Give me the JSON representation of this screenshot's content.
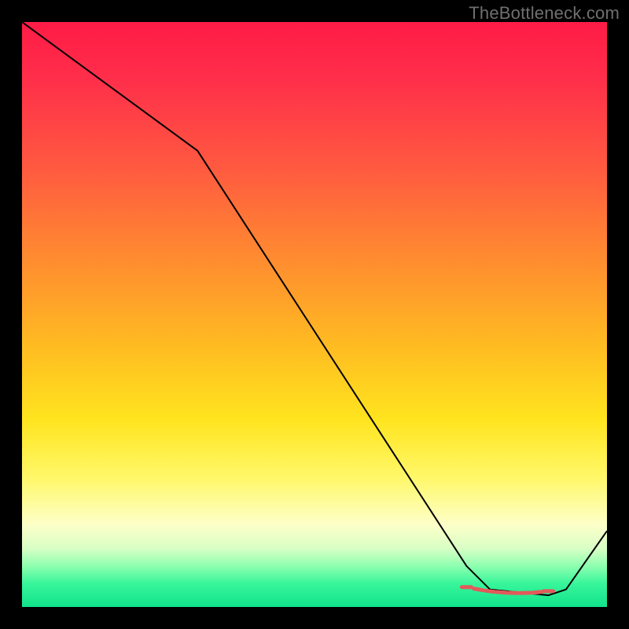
{
  "watermark": "TheBottleneck.com",
  "chart_data": {
    "type": "line",
    "title": "",
    "xlabel": "",
    "ylabel": "",
    "xlim": [
      0,
      100
    ],
    "ylim": [
      0,
      100
    ],
    "grid": false,
    "legend": false,
    "background_gradient": {
      "orientation": "vertical",
      "stops": [
        {
          "pos": 0.0,
          "color": "#ff1b46"
        },
        {
          "pos": 0.25,
          "color": "#ff5a40"
        },
        {
          "pos": 0.55,
          "color": "#ffba22"
        },
        {
          "pos": 0.78,
          "color": "#fff86a"
        },
        {
          "pos": 0.93,
          "color": "#8dffb0"
        },
        {
          "pos": 1.0,
          "color": "#11e38b"
        }
      ]
    },
    "series": [
      {
        "name": "curve",
        "color": "#000000",
        "style": "line",
        "x": [
          0,
          30,
          76,
          80,
          90,
          93,
          100
        ],
        "values": [
          100,
          78,
          7,
          3,
          2,
          3,
          13
        ]
      },
      {
        "name": "optimum-markers",
        "color": "#e25a5a",
        "style": "markers",
        "x": [
          76,
          78,
          80,
          82,
          84,
          86,
          88,
          90
        ],
        "values": [
          3.4,
          3.0,
          2.7,
          2.5,
          2.4,
          2.4,
          2.5,
          2.7
        ]
      }
    ]
  }
}
